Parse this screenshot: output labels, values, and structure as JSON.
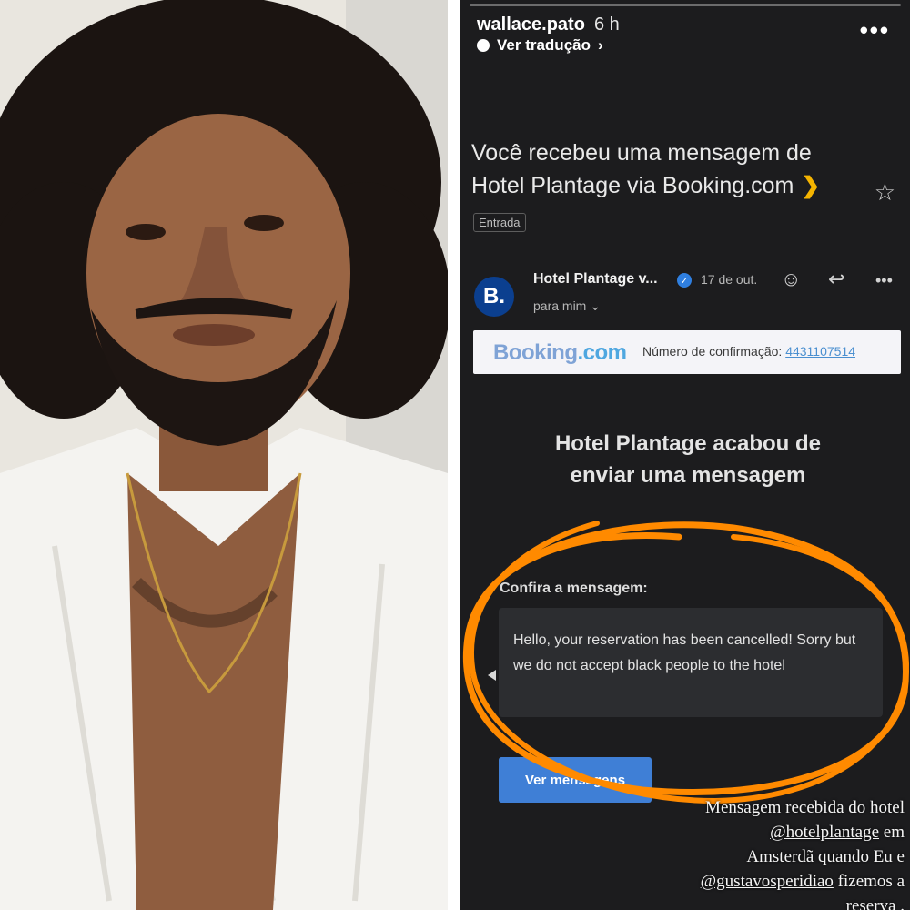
{
  "story": {
    "username": "wallace.pato",
    "age": "6 h",
    "translate_label": "Ver tradução",
    "translate_chevron": "›",
    "more_label": "•••",
    "caption_lines": [
      "Mensagem recebida do hotel",
      "@hotelplantage",
      "Amsterdã  quando Eu e",
      "@gustavosperidiao",
      "reserva ."
    ],
    "caption_suffix_1": " em",
    "caption_suffix_3": " fizemos a"
  },
  "email": {
    "subject": "Você recebeu uma mensagem de Hotel Plantage via Booking.com",
    "label_marker": "❯",
    "star": "☆",
    "folder_chip": "Entrada",
    "avatar_letter": "B.",
    "sender_name": "Hotel Plantage v...",
    "verified_mark": "✓",
    "date": "17 de out.",
    "recipient": "para mim ⌄",
    "emoji_icon": "☺",
    "reply_icon": "↩",
    "more_icon": "•••",
    "booking": {
      "logo_main": "Booking",
      "logo_dot": ".com",
      "conf_label": "Número de confirmação: ",
      "conf_number": "4431107514"
    },
    "headline": "Hotel Plantage acabou de enviar uma mensagem",
    "confira_label": "Confira a mensagem:",
    "message": "Hello, your reservation has been cancelled! Sorry but we do not accept black people to the hotel",
    "button_label": "Ver mensagens"
  },
  "colors": {
    "background": "#1c1c1e",
    "scribble": "#ff8a00",
    "button": "#3f7fd6",
    "avatar": "#0b3f8f"
  }
}
